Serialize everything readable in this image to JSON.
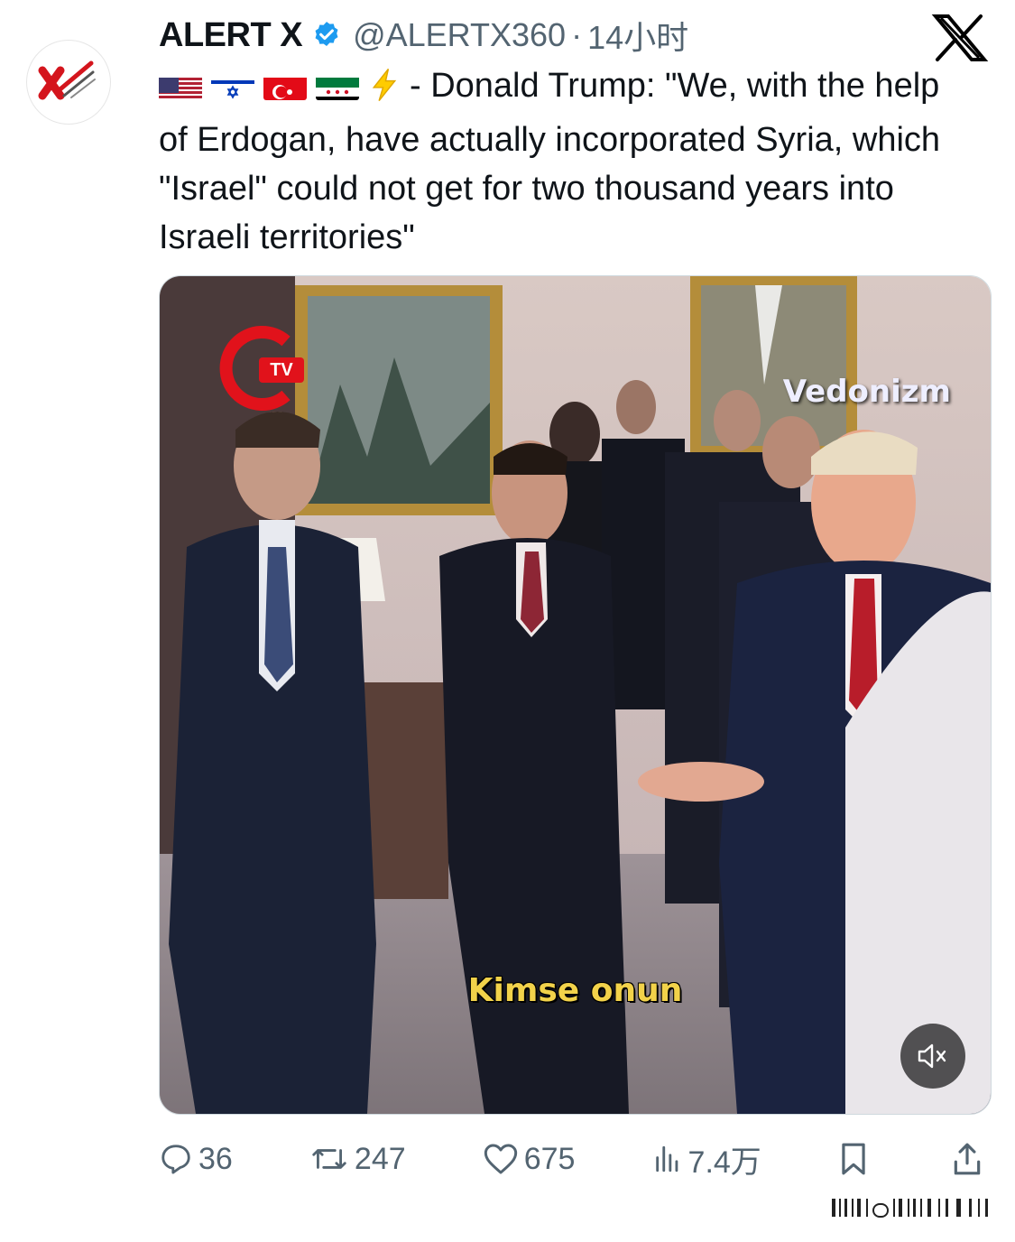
{
  "account": {
    "name": "ALERT X",
    "handle": "@ALERTX360",
    "separator": "·",
    "time": "14小时"
  },
  "tweet": {
    "flags": [
      "us-flag",
      "israel-flag",
      "turkey-flag",
      "syria-flag"
    ],
    "bolt_icon": "lightning-icon",
    "text": "- Donald Trump: \"We, with the help of Erdogan, have actually incorporated Syria, which \"Israel\" could not get for two thousand years into Israeli territories\""
  },
  "media": {
    "watermark_left": "TV",
    "watermark_right": "Vedonizm",
    "subtitle": "Kimse onun",
    "mute_icon": "mute-icon"
  },
  "actions": {
    "replies": "36",
    "reposts": "247",
    "likes": "675",
    "views": "7.4万"
  },
  "colors": {
    "verified": "#1d9bf0",
    "text": "#0f1419",
    "muted": "#536471",
    "subtitle": "#f2d24a"
  }
}
